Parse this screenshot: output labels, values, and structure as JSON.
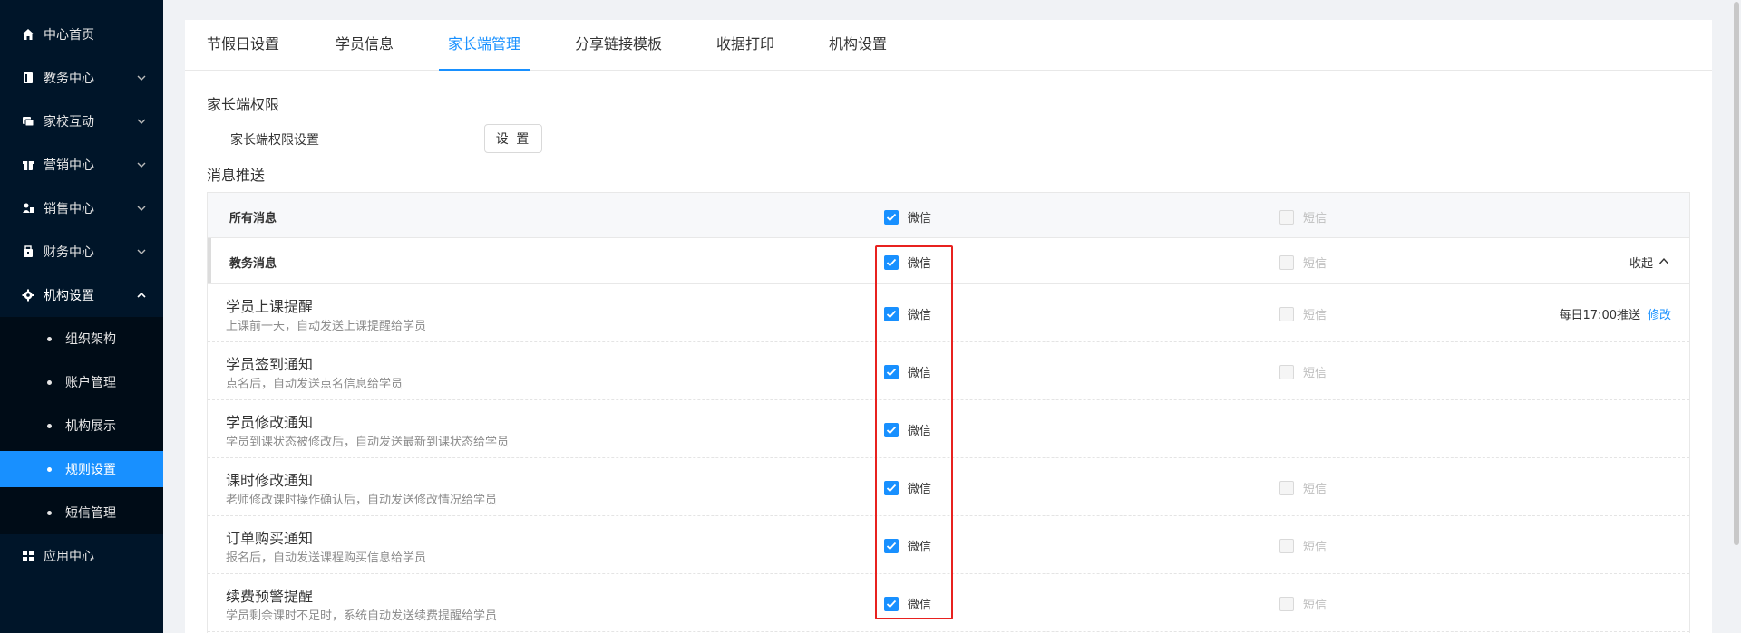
{
  "sidebar": {
    "items": [
      {
        "label": "中心首页",
        "icon": "home-icon"
      },
      {
        "label": "教务中心",
        "icon": "book-icon"
      },
      {
        "label": "家校互动",
        "icon": "chat-icon"
      },
      {
        "label": "营销中心",
        "icon": "gift-icon"
      },
      {
        "label": "销售中心",
        "icon": "users-icon"
      },
      {
        "label": "财务中心",
        "icon": "wallet-icon"
      },
      {
        "label": "机构设置",
        "icon": "gear-icon"
      },
      {
        "label": "应用中心",
        "icon": "apps-icon"
      }
    ],
    "sub_items": [
      {
        "label": "组织架构"
      },
      {
        "label": "账户管理"
      },
      {
        "label": "机构展示"
      },
      {
        "label": "规则设置"
      },
      {
        "label": "短信管理"
      }
    ],
    "active_sub": "规则设置",
    "colors": {
      "bg": "#001529",
      "submenu_bg": "#000c17",
      "active": "#1890ff"
    }
  },
  "tabs": [
    {
      "label": "节假日设置"
    },
    {
      "label": "学员信息"
    },
    {
      "label": "家长端管理"
    },
    {
      "label": "分享链接模板"
    },
    {
      "label": "收据打印"
    },
    {
      "label": "机构设置"
    }
  ],
  "active_tab": "家长端管理",
  "permissions": {
    "title": "家长端权限",
    "row_label": "家长端权限设置",
    "button_label": "设 置"
  },
  "push": {
    "title": "消息推送",
    "all_row": {
      "label": "所有消息",
      "wechat": "微信",
      "sms": "短信",
      "wechat_checked": true,
      "sms_checked": false
    },
    "group_row": {
      "label": "教务消息",
      "wechat": "微信",
      "sms": "短信",
      "collapse_label": "收起",
      "wechat_checked": true,
      "sms_checked": false
    },
    "rows": [
      {
        "title": "学员上课提醒",
        "desc": "上课前一天，自动发送上课提醒给学员",
        "wechat": "微信",
        "sms": "短信",
        "schedule": "每日17:00推送",
        "edit": "修改"
      },
      {
        "title": "学员签到通知",
        "desc": "点名后，自动发送点名信息给学员",
        "wechat": "微信",
        "sms": "短信"
      },
      {
        "title": "学员修改通知",
        "desc": "学员到课状态被修改后，自动发送最新到课状态给学员",
        "wechat": "微信"
      },
      {
        "title": "课时修改通知",
        "desc": "老师修改课时操作确认后，自动发送修改情况给学员",
        "wechat": "微信",
        "sms": "短信"
      },
      {
        "title": "订单购买通知",
        "desc": "报名后，自动发送课程购买信息给学员",
        "wechat": "微信",
        "sms": "短信"
      },
      {
        "title": "续费预警提醒",
        "desc": "学员剩余课时不足时，系统自动发送续费提醒给学员",
        "wechat": "微信",
        "sms": "短信"
      }
    ]
  },
  "colors": {
    "primary": "#1890ff",
    "highlight_border": "#e8211f"
  }
}
